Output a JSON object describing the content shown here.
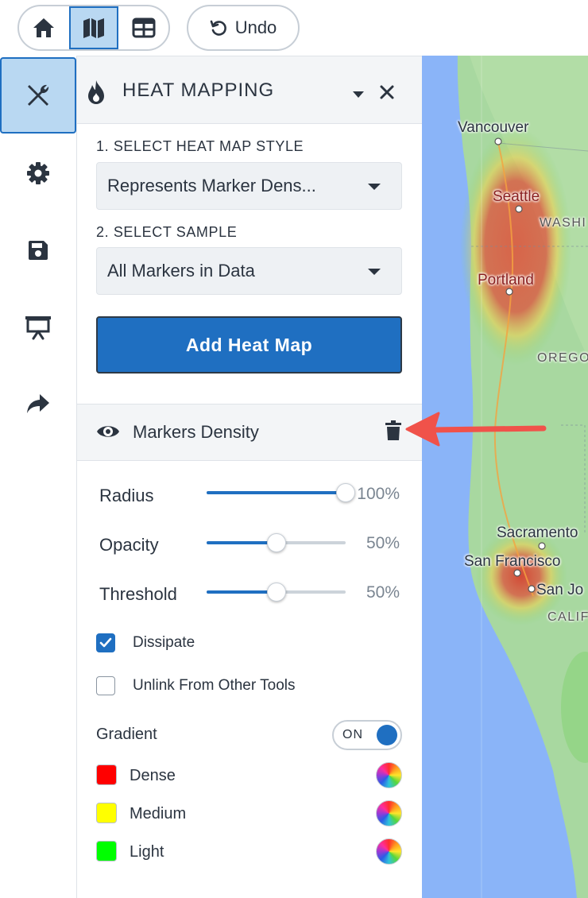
{
  "toolbar": {
    "view_buttons": [
      "home",
      "map",
      "table"
    ],
    "active_view": "map",
    "undo_label": "Undo"
  },
  "rail": {
    "items": [
      "tools-icon",
      "gear-icon",
      "save-icon",
      "presentation-icon",
      "share-icon"
    ],
    "active": "tools-icon"
  },
  "panel": {
    "title": "HEAT MAPPING",
    "step1_label": "1. SELECT HEAT MAP STYLE",
    "style_value": "Represents Marker Dens...",
    "step2_label": "2. SELECT SAMPLE",
    "sample_value": "All Markers in Data",
    "add_button": "Add Heat Map"
  },
  "layer": {
    "name": "Markers Density",
    "radius_label": "Radius",
    "radius_value": "100%",
    "radius_level": 1.0,
    "opacity_label": "Opacity",
    "opacity_value": "50%",
    "opacity_level": 0.5,
    "threshold_label": "Threshold",
    "threshold_value": "50%",
    "threshold_level": 0.5,
    "dissipate_label": "Dissipate",
    "dissipate_checked": true,
    "unlink_label": "Unlink From Other Tools",
    "unlink_checked": false,
    "gradient_label": "Gradient",
    "gradient_toggle": "ON",
    "gradients": [
      {
        "label": "Dense",
        "color": "#ff0000"
      },
      {
        "label": "Medium",
        "color": "#ffff00"
      },
      {
        "label": "Light",
        "color": "#00ff00"
      }
    ]
  },
  "map": {
    "labels": {
      "vancouver": "Vancouver",
      "seattle": "Seattle",
      "washi": "WASHI",
      "portland": "Portland",
      "orego": "OREGO",
      "sacramento": "Sacramento",
      "san_francisco": "San Francisco",
      "san_jose": "San Jo",
      "calif": "CALIF"
    },
    "colors": {
      "water": "#8ab4f8",
      "land": "#a8d8a0",
      "heat_red": "#e0503a"
    }
  }
}
